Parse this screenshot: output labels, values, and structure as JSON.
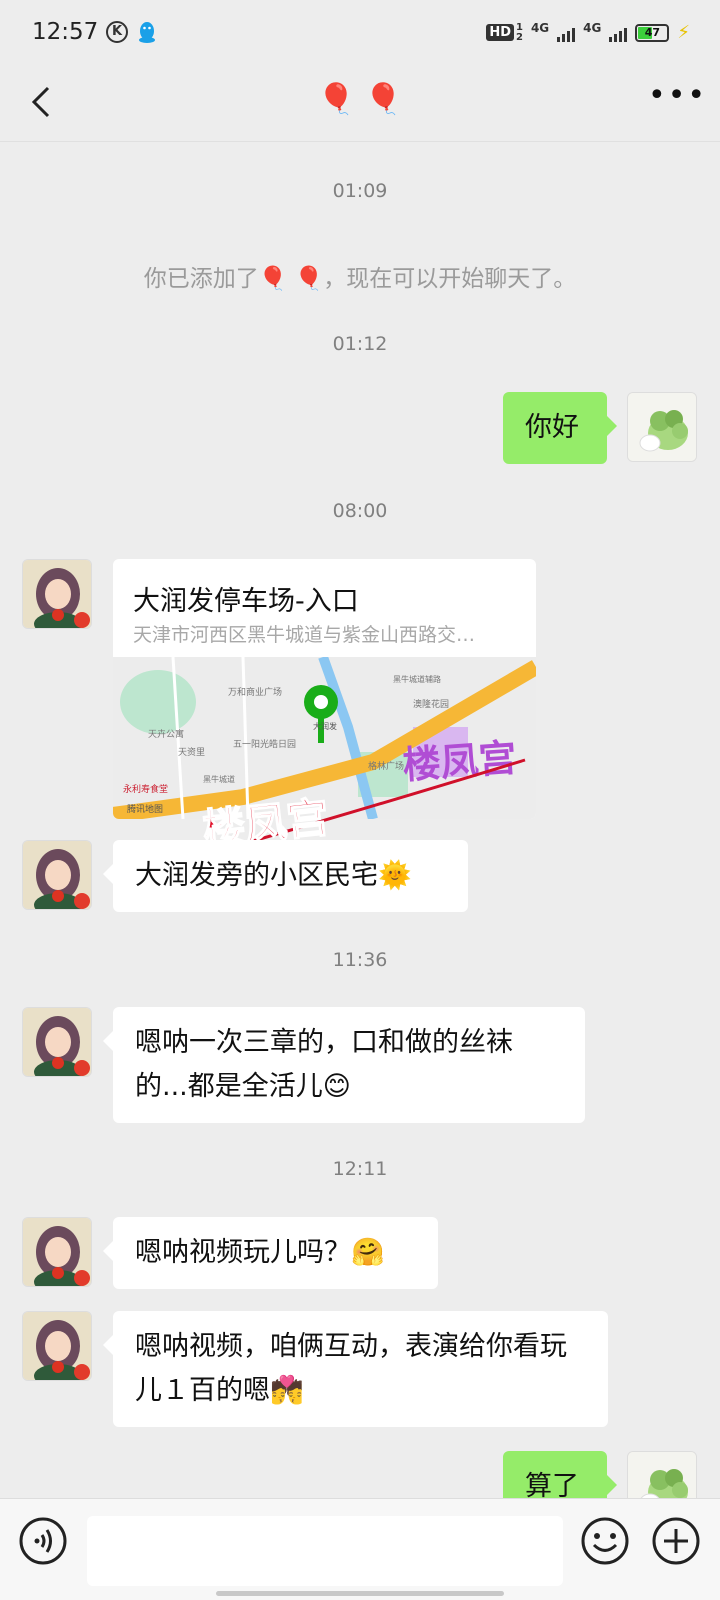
{
  "status_bar": {
    "time": "12:57",
    "k_badge": "K",
    "hd": "HD",
    "sim1": "1",
    "sim2": "2",
    "net1": "4G",
    "net2": "4G",
    "battery": "47",
    "battery_level": 0.47
  },
  "header": {
    "title": "🎈 🎈"
  },
  "messages": {
    "ts1": "01:09",
    "system_notice": "你已添加了🎈 🎈，现在可以开始聊天了。",
    "ts2": "01:12",
    "out1": "你好",
    "ts3": "08:00",
    "location": {
      "title": "大润发停车场-入口",
      "address": "天津市河西区黑牛城道与紫金山西路交…",
      "map_labels": [
        "万和商业广场",
        "天卉公寓",
        "天资里",
        "五一阳光皓日园",
        "黑牛城道辅路",
        "黑牛城道",
        "澳隆花园",
        "格林广场",
        "永利寿食堂",
        "腾讯地图",
        "大润发"
      ],
      "watermark": "楼凤宫"
    },
    "in2": "大润发旁的小区民宅🌞",
    "ts4": "11:36",
    "in3": "嗯呐一次三章的，口和做的丝袜的...都是全活儿😊",
    "ts5": "12:11",
    "in4": "嗯呐视频玩儿吗？🤗",
    "in5": "嗯呐视频，咱俩互动，表演给你看玩儿１百的嗯💏",
    "out2": "算了"
  },
  "colors": {
    "background": "#ededed",
    "outgoing_bubble": "#95ec69",
    "incoming_bubble": "#ffffff",
    "timestamp_text": "#808080"
  },
  "input": {
    "placeholder": ""
  }
}
